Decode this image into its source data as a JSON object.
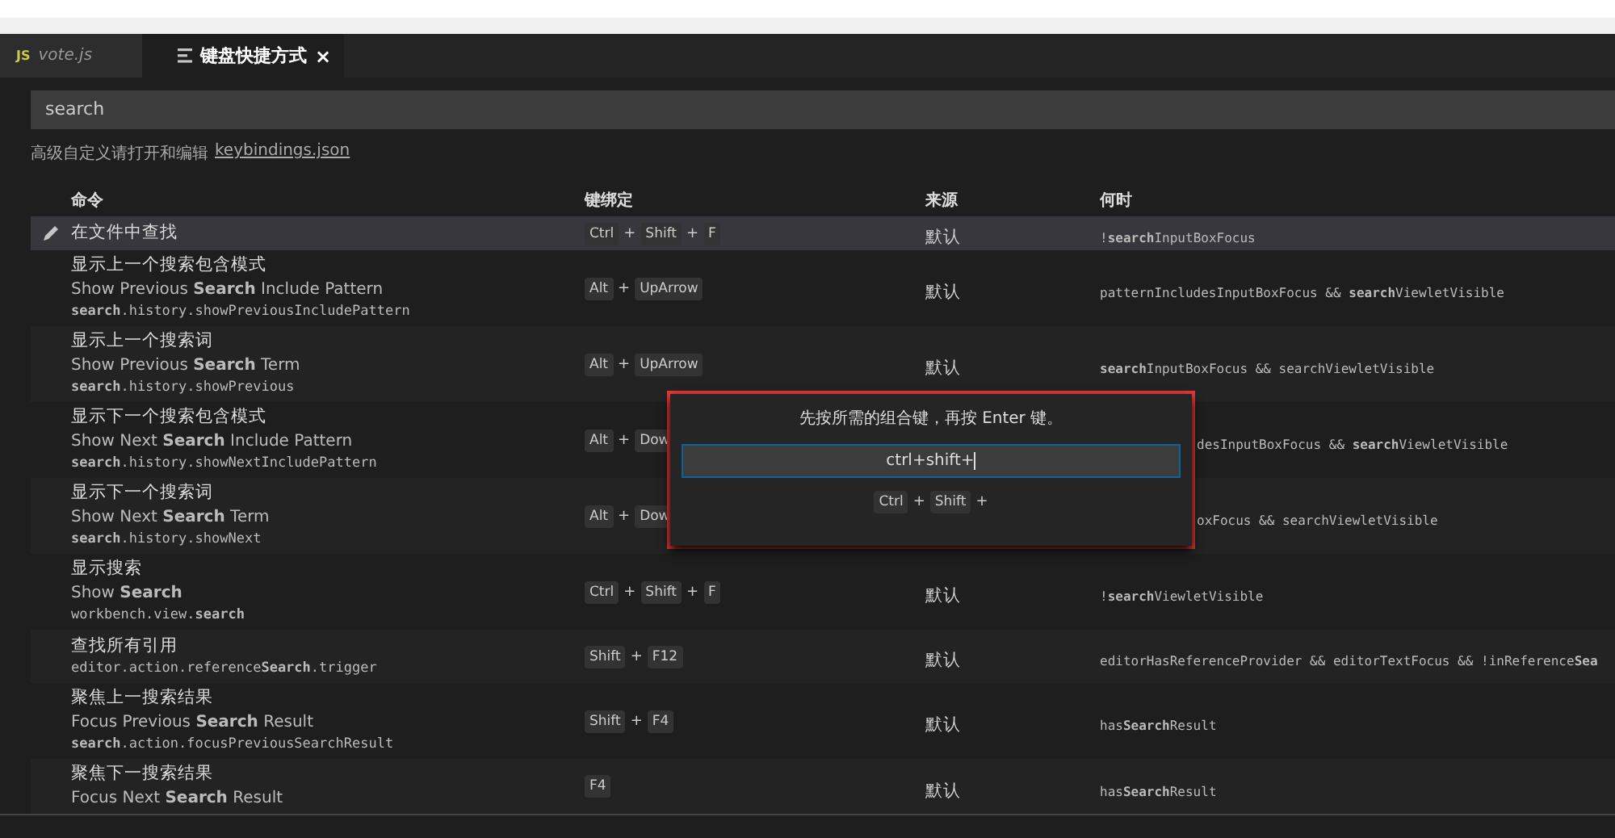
{
  "tabs": [
    {
      "icon_text": "JS",
      "label": "vote.js",
      "selected": false
    },
    {
      "label": "键盘快捷方式",
      "close": "×",
      "selected": true
    }
  ],
  "search": {
    "value": "search"
  },
  "hint": {
    "text": "高级自定义请打开和编辑",
    "link": "keybindings.json"
  },
  "table": {
    "columns": [
      "命令",
      "键绑定",
      "来源",
      "何时"
    ],
    "rows": [
      {
        "title": "在文件中查找",
        "selected": true,
        "kind": "normal",
        "keys": [
          {
            "kind": "key",
            "text": "Ctrl"
          },
          {
            "kind": "sep",
            "text": "+"
          },
          {
            "kind": "key",
            "text": "Shift"
          },
          {
            "kind": "sep",
            "text": "+"
          },
          {
            "kind": "key",
            "text": "F"
          }
        ],
        "source": "默认",
        "when": "!**search**InputBoxFocus"
      },
      {
        "title": "显示上一个搜索包含模式",
        "label": "Show Previous **Search** Include Pattern",
        "command": "**search**.history.showPreviousIncludePattern",
        "selected": false,
        "kind": "normal",
        "keys": [
          {
            "kind": "key",
            "text": "Alt"
          },
          {
            "kind": "sep",
            "text": "+"
          },
          {
            "kind": "key",
            "text": "UpArrow"
          }
        ],
        "source": "默认",
        "when": "patternIncludesInputBoxFocus && **search**ViewletVisible"
      },
      {
        "title": "显示上一个搜索词",
        "label": "Show Previous **Search** Term",
        "command": "**search**.history.showPrevious",
        "selected": false,
        "kind": "normal",
        "keys": [
          {
            "kind": "key",
            "text": "Alt"
          },
          {
            "kind": "sep",
            "text": "+"
          },
          {
            "kind": "key",
            "text": "UpArrow"
          }
        ],
        "source": "默认",
        "when": "**search**InputBoxFocus && searchViewletVisible"
      },
      {
        "title": "显示下一个搜索包含模式",
        "label": "Show Next **Search** Include Pattern",
        "command": "**search**.history.showNextIncludePattern",
        "selected": false,
        "kind": "covered",
        "keys": [
          {
            "kind": "key",
            "text": "Alt"
          },
          {
            "kind": "sep",
            "text": "+"
          },
          {
            "kind": "key",
            "text": "Dow"
          }
        ],
        "when": "desInputBoxFocus && **search**ViewletVisible"
      },
      {
        "title": "显示下一个搜索词",
        "label": "Show Next **Search** Term",
        "command": "**search**.history.showNext",
        "selected": false,
        "kind": "covered",
        "keys": [
          {
            "kind": "key",
            "text": "Alt"
          },
          {
            "kind": "sep",
            "text": "+"
          },
          {
            "kind": "key",
            "text": "Dow"
          }
        ],
        "when": "oxFocus && searchViewletVisible"
      },
      {
        "title": "显示搜索",
        "label": "Show **Search**",
        "command": "workbench.view.**search**",
        "selected": false,
        "kind": "normal",
        "keys": [
          {
            "kind": "key",
            "text": "Ctrl"
          },
          {
            "kind": "sep",
            "text": "+"
          },
          {
            "kind": "key",
            "text": "Shift"
          },
          {
            "kind": "sep",
            "text": "+"
          },
          {
            "kind": "key",
            "text": "F"
          }
        ],
        "source": "默认",
        "when": "!**search**ViewletVisible"
      },
      {
        "title": "查找所有引用",
        "command": "editor.action.reference**Search**.trigger",
        "selected": false,
        "kind": "normal",
        "keys": [
          {
            "kind": "key",
            "text": "Shift"
          },
          {
            "kind": "sep",
            "text": "+"
          },
          {
            "kind": "key",
            "text": "F12"
          }
        ],
        "source": "默认",
        "when": "editorHasReferenceProvider && editorTextFocus && !inReference**Sea**"
      },
      {
        "title": "聚焦上一搜索结果",
        "label": "Focus Previous **Search** Result",
        "command": "**search**.action.focusPreviousSearchResult",
        "selected": false,
        "kind": "normal",
        "keys": [
          {
            "kind": "key",
            "text": "Shift"
          },
          {
            "kind": "sep",
            "text": "+"
          },
          {
            "kind": "key",
            "text": "F4"
          }
        ],
        "source": "默认",
        "when": "has**Search**Result"
      },
      {
        "title": "聚焦下一搜索结果",
        "label": "Focus Next **Search** Result",
        "selected": false,
        "kind": "normal",
        "keys": [
          {
            "kind": "key",
            "text": "F4"
          }
        ],
        "source": "默认",
        "when": "has**Search**Result"
      }
    ]
  },
  "dialog": {
    "message": "先按所需的组合键，再按 Enter 键。",
    "value": "ctrl+shift+",
    "keys": [
      {
        "kind": "key",
        "text": "Ctrl"
      },
      {
        "kind": "sep",
        "text": "+"
      },
      {
        "kind": "key",
        "text": "Shift"
      },
      {
        "kind": "sep",
        "text": "+"
      }
    ]
  }
}
